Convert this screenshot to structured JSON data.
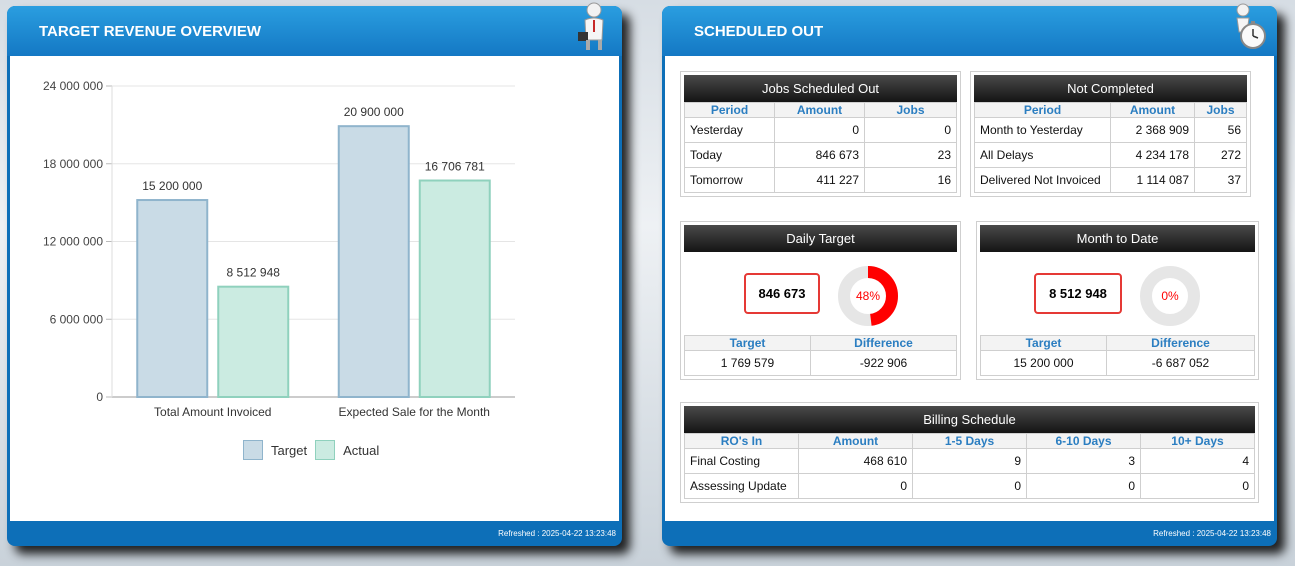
{
  "left_panel": {
    "title": "TARGET REVENUE OVERVIEW",
    "refreshed": "Refreshed : 2025-04-22 13:23:48"
  },
  "right_panel": {
    "title": "SCHEDULED OUT",
    "refreshed": "Refreshed : 2025-04-22 13:23:48"
  },
  "chart_data": {
    "type": "bar",
    "categories": [
      "Total Amount Invoiced",
      "Expected Sale for the Month"
    ],
    "series": [
      {
        "name": "Target",
        "values": [
          15200000,
          20900000
        ],
        "labels": [
          "15 200 000",
          "20 900 000"
        ],
        "fill": "#c9dbe6",
        "stroke": "#8fb4cc"
      },
      {
        "name": "Actual",
        "values": [
          8512948,
          16706781
        ],
        "labels": [
          "8 512 948",
          "16 706 781"
        ],
        "fill": "#cbebe1",
        "stroke": "#8fd1bd"
      }
    ],
    "ylim": [
      0,
      24000000
    ],
    "yticks": [
      0,
      6000000,
      12000000,
      18000000,
      24000000
    ],
    "ytick_labels": [
      "0",
      "6 000 000",
      "12 000 000",
      "18 000 000",
      "24 000 000"
    ],
    "grid": true,
    "legend": "bottom"
  },
  "jobs_scheduled": {
    "title": "Jobs Scheduled Out",
    "headers": [
      "Period",
      "Amount",
      "Jobs"
    ],
    "rows": [
      [
        "Yesterday",
        "0",
        "0"
      ],
      [
        "Today",
        "846 673",
        "23"
      ],
      [
        "Tomorrow",
        "411 227",
        "16"
      ]
    ]
  },
  "not_completed": {
    "title": "Not Completed",
    "headers": [
      "Period",
      "Amount",
      "Jobs"
    ],
    "rows": [
      [
        "Month to Yesterday",
        "2 368 909",
        "56"
      ],
      [
        "All Delays",
        "4 234 178",
        "272"
      ],
      [
        "Delivered Not Invoiced",
        "1 114 087",
        "37"
      ]
    ]
  },
  "daily_target": {
    "title": "Daily Target",
    "value": "846 673",
    "percent_label": "48%",
    "percent": 48,
    "accent": "#ff0000",
    "headers": [
      "Target",
      "Difference"
    ],
    "row": [
      "1 769 579",
      "-922 906"
    ]
  },
  "month_to_date": {
    "title": "Month to Date",
    "value": "8 512 948",
    "percent_label": "0%",
    "percent": 0,
    "accent": "#ff0000",
    "headers": [
      "Target",
      "Difference"
    ],
    "row": [
      "15 200 000",
      "-6 687 052"
    ]
  },
  "billing_schedule": {
    "title": "Billing Schedule",
    "headers": [
      "RO's In",
      "Amount",
      "1-5 Days",
      "6-10 Days",
      "10+ Days"
    ],
    "rows": [
      [
        "Final Costing",
        "468 610",
        "9",
        "3",
        "4"
      ],
      [
        "Assessing Update",
        "0",
        "0",
        "0",
        "0"
      ]
    ]
  },
  "icons": {
    "left_mascot": "businessman-figure-icon",
    "right_mascot": "stopwatch-figure-icon"
  }
}
